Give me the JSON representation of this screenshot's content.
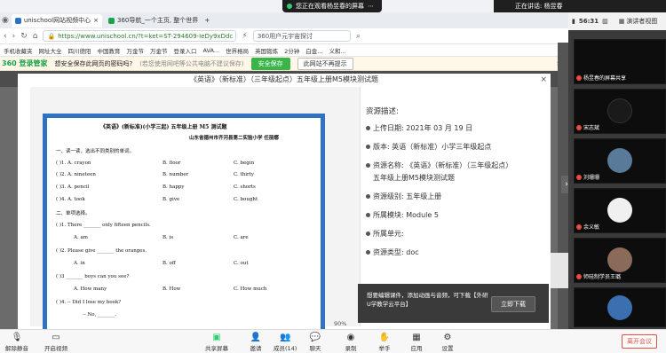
{
  "meeting": {
    "banner_text": "您正在观看杨昱春的屏幕",
    "speaking_text": "正在讲话: 杨昱春",
    "time": "56:31",
    "view_button": "演讲者视图"
  },
  "browser": {
    "tabs": [
      {
        "label": "unischool网站视频中心",
        "active": true
      },
      {
        "label": "360导航_一个主页, 整个世界",
        "active": false
      }
    ],
    "url": "https://www.unischool.cn/?t=ket=ST-294609-IeDy9xDdc",
    "search_placeholder": "360用户元宇宙探讨",
    "bookmarks": [
      "手机收藏夹",
      "网址大全",
      "四川德阳",
      "中国教育",
      "万金节",
      "万金节",
      "登录入口",
      "AVA...",
      "世界格局",
      "英国锻炼",
      "2分钟",
      "白金...",
      "义和..."
    ],
    "password_bar": {
      "brand": "360 登录管家",
      "question": "想安全保存此网页的密码吗?",
      "note": "(若您使用网吧等公共电脑不建议保存)",
      "save_label": "安全保存",
      "no_prompt_label": "此网站不再提示"
    }
  },
  "modal": {
    "title": "《英语》（新标准）（三年级起点）五年级上册M5模块测试题",
    "zoom": "90%",
    "document_lines": [
      "《英语》(新标准)(小学三起) 五年级上册  M5 测试题",
      "山东省德州市齐河县第二实验小学  任丽娜",
      "一、读一读，选出不同类别的单词。",
      "(      )1. A. crayon",
      "B. floor",
      "C. begin",
      "(      )2. A. nineteen",
      "B. number",
      "C. thirty",
      "(      )3. A. pencil",
      "B. happy",
      "C. shorts",
      "(      )4. A. took",
      "B. give",
      "C. bought",
      "二、单项选择。",
      "(      )1. There _______ only fifteen pencils.",
      "A. am",
      "B. is",
      "C. are",
      "(      )2. Please give _______ the oranges.",
      "A. in",
      "B. off",
      "C. out",
      "(      )3 _______ boys can you see?",
      "A. How many",
      "B. How",
      "C. How much",
      "(      )4. -- Did I lose my book?",
      "-- No, _______."
    ],
    "info": {
      "heading": "资源描述:",
      "rows": [
        "上传日期: 2021年 03 月 19 日",
        "版本: 英语（新标准）小学三年级起点",
        "资源名称: 《英语》（新标准）（三年级起点）",
        "五年级上册M5模块测试题",
        "资源级别: 五年级上册",
        "所属模块: Module 5",
        "所属单元:",
        "资源类型: doc"
      ]
    },
    "tooltip": {
      "text": "想要编辑课件，添加动画与音频，可下载【外研U学教学云平台】",
      "button": "立即下载"
    }
  },
  "participants": [
    {
      "name": "杨昱春的屏幕共享",
      "avatar_color": "#1a1a1a"
    },
    {
      "name": "宋志斌",
      "avatar_color": "#0d0d0d"
    },
    {
      "name": "刘珊珊",
      "avatar_color": "#5a7a9a"
    },
    {
      "name": "余义敏",
      "avatar_color": "#f0f0f0"
    },
    {
      "name": "师硅制学员王璐",
      "avatar_color": "#8a6a58"
    },
    {
      "name": "",
      "avatar_color": "#3a6fb0"
    }
  ],
  "toolbar": {
    "unmute": "解除静音",
    "video": "开启视频",
    "share": "共享屏幕",
    "invite": "邀请",
    "members": "成员(14)",
    "chat": "聊天",
    "record": "录制",
    "raise_hand": "举手",
    "apps": "应用",
    "settings": "设置",
    "leave": "离开会议"
  },
  "colors": {
    "accent_green": "#39b54a",
    "doc_border": "#2f72c2",
    "leave_red": "#e74c3c"
  }
}
